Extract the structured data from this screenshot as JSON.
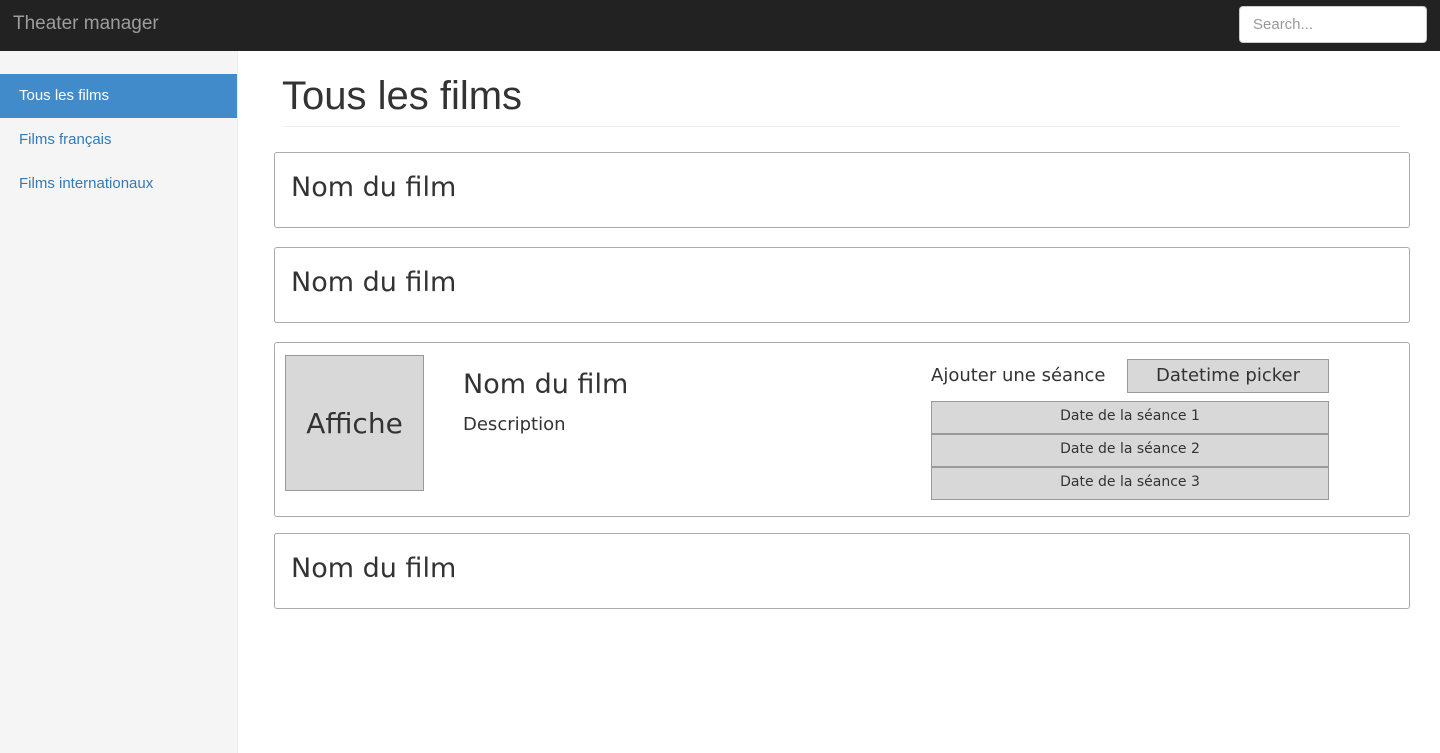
{
  "navbar": {
    "brand": "Theater manager",
    "search_placeholder": "Search..."
  },
  "sidebar": {
    "items": [
      {
        "label": "Tous les films",
        "active": true
      },
      {
        "label": "Films français",
        "active": false
      },
      {
        "label": "Films internationaux",
        "active": false
      }
    ]
  },
  "main": {
    "title": "Tous les films",
    "films": [
      {
        "name": "Nom du film"
      },
      {
        "name": "Nom du film"
      },
      {
        "name": "Nom du film",
        "poster_label": "Affiche",
        "description": "Description",
        "add_session_label": "Ajouter une séance",
        "datetime_picker_label": "Datetime picker",
        "sessions": [
          "Date de la séance 1",
          "Date de la séance 2",
          "Date de la séance 3"
        ]
      },
      {
        "name": "Nom du film"
      }
    ]
  },
  "colors": {
    "navbar_bg": "#222222",
    "sidebar_bg": "#f5f5f5",
    "active_item_bg": "#428bca",
    "link": "#337ab7"
  }
}
